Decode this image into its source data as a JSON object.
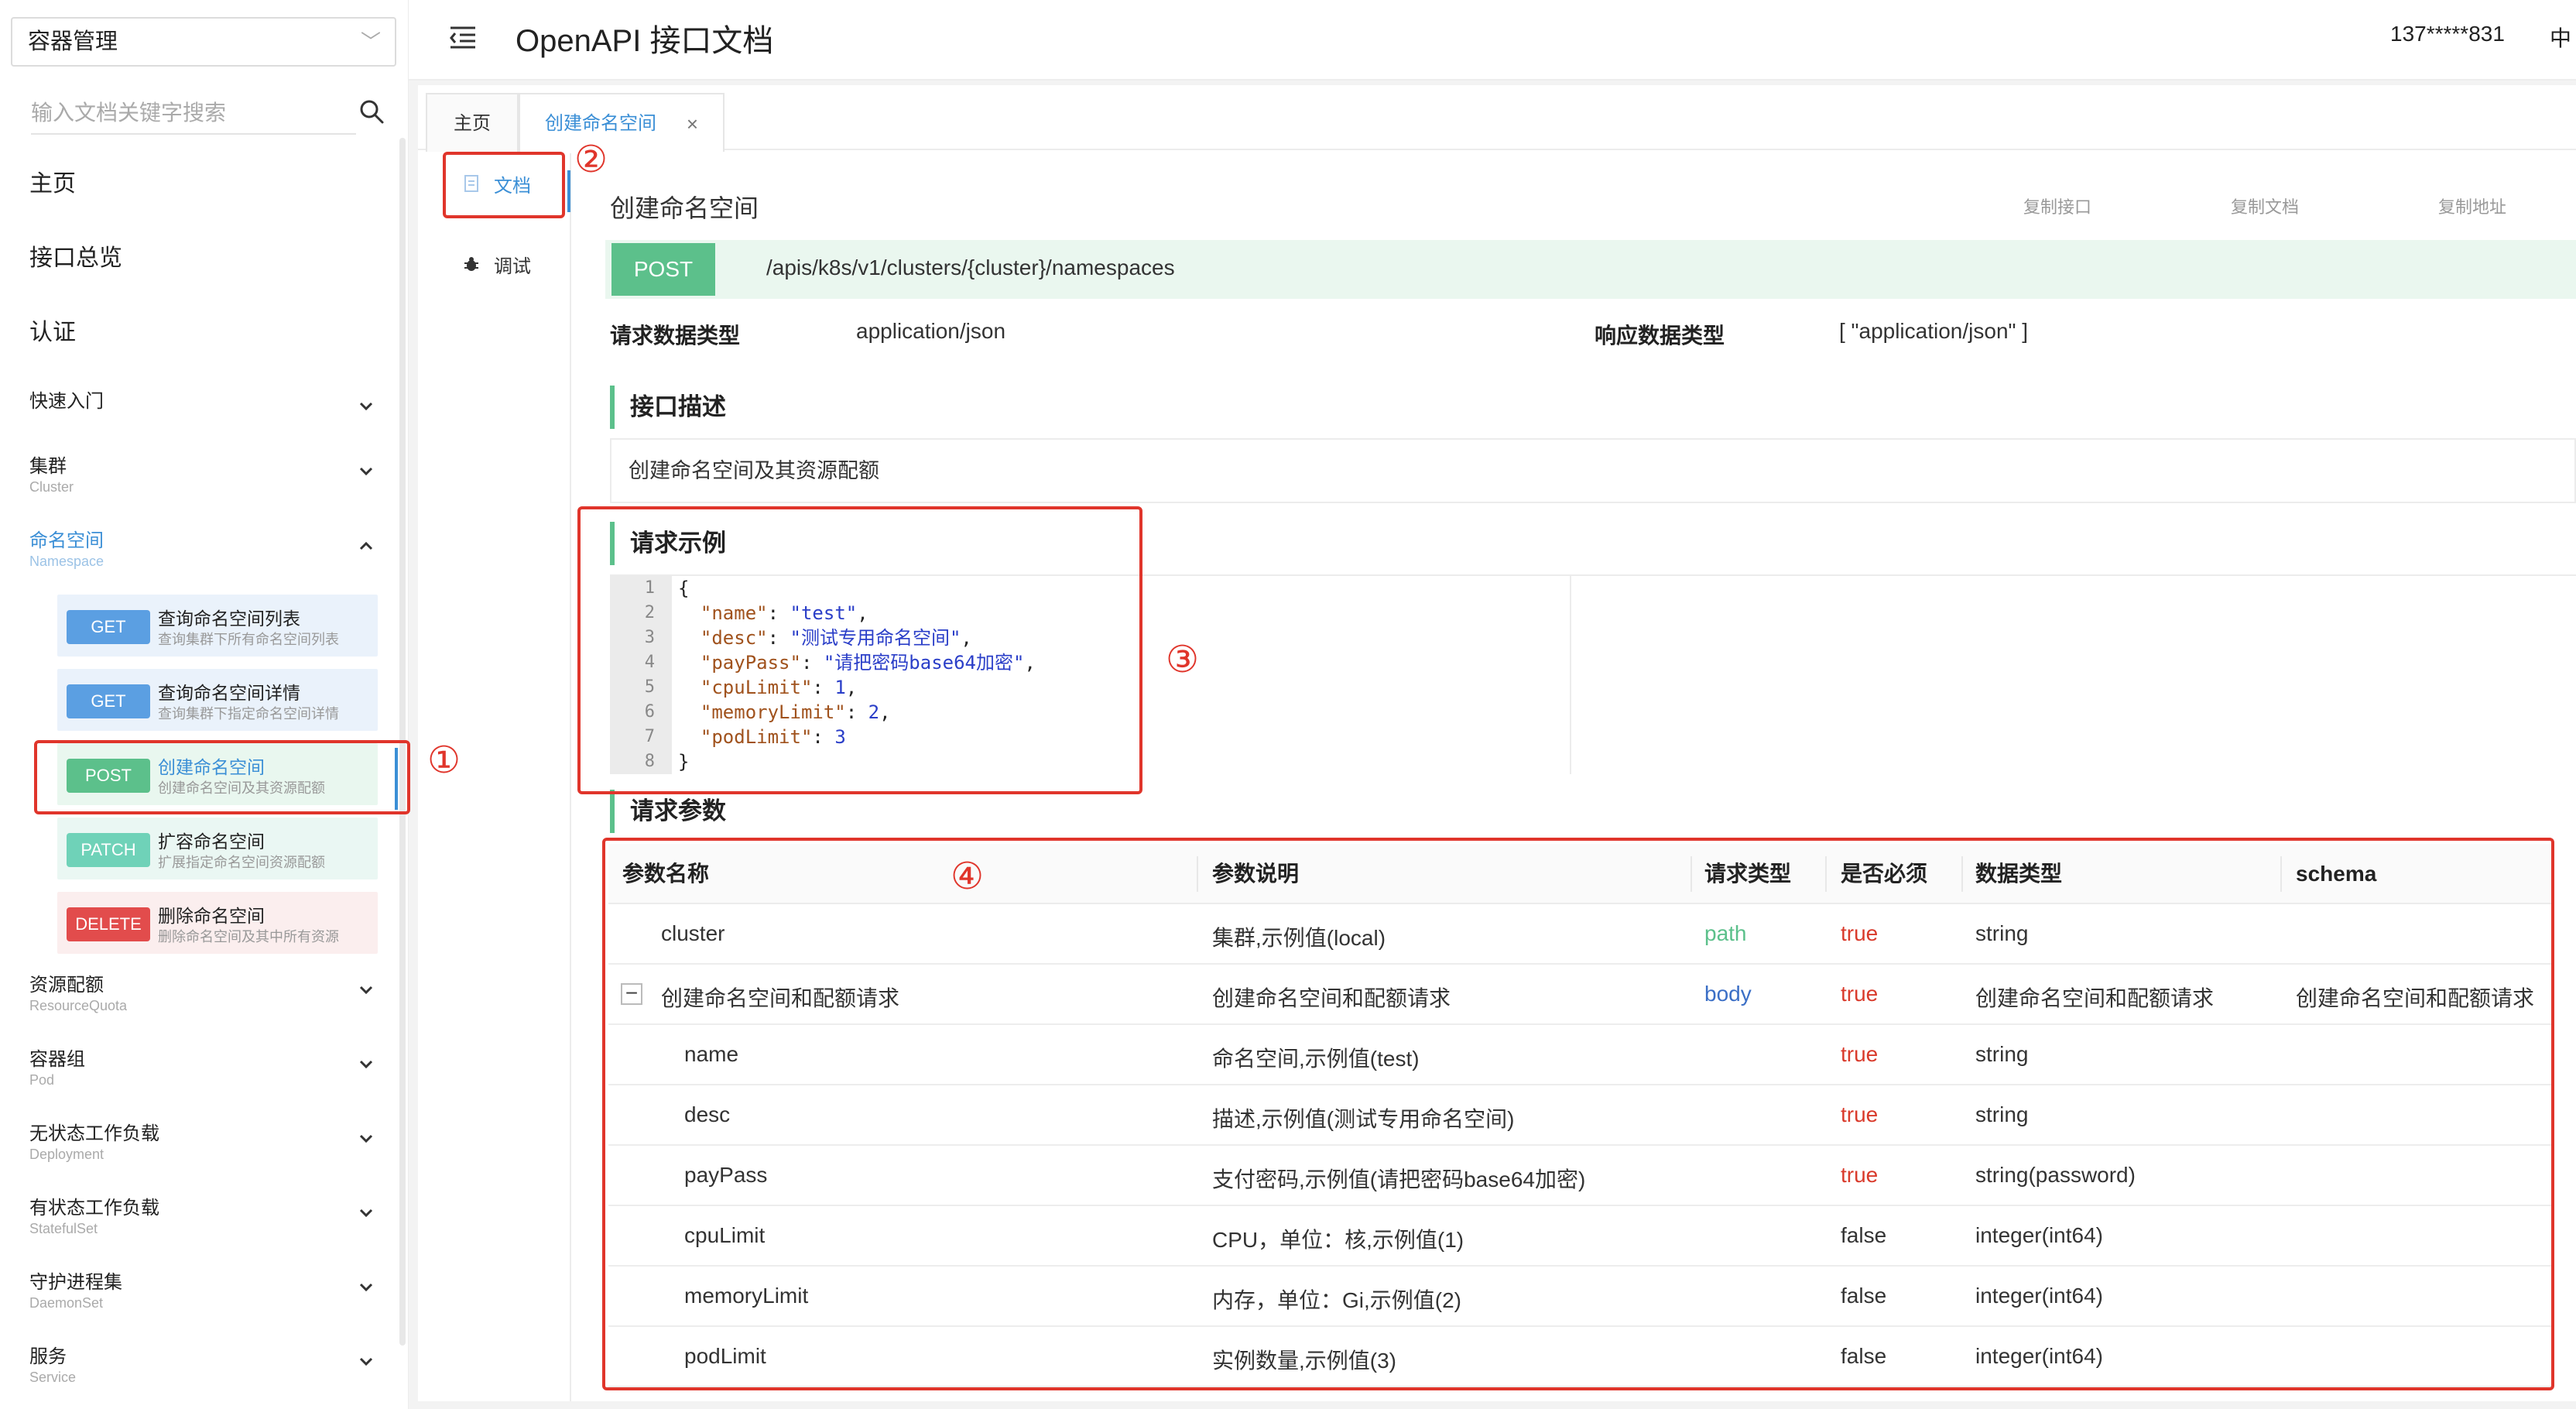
{
  "sidebar": {
    "project_select": "容器管理",
    "search_placeholder": "输入文档关键字搜索",
    "simple_items": [
      "主页",
      "接口总览",
      "认证"
    ],
    "groups": [
      {
        "title": "快速入门",
        "subtitle": ""
      },
      {
        "title": "集群",
        "subtitle": "Cluster"
      },
      {
        "title": "命名空间",
        "subtitle": "Namespace"
      },
      {
        "title": "资源配额",
        "subtitle": "ResourceQuota"
      },
      {
        "title": "容器组",
        "subtitle": "Pod"
      },
      {
        "title": "无状态工作负载",
        "subtitle": "Deployment"
      },
      {
        "title": "有状态工作负载",
        "subtitle": "StatefulSet"
      },
      {
        "title": "守护进程集",
        "subtitle": "DaemonSet"
      },
      {
        "title": "服务",
        "subtitle": "Service"
      }
    ],
    "apis": [
      {
        "method": "GET",
        "name": "查询命名空间列表",
        "desc": "查询集群下所有命名空间列表"
      },
      {
        "method": "GET",
        "name": "查询命名空间详情",
        "desc": "查询集群下指定命名空间详情"
      },
      {
        "method": "POST",
        "name": "创建命名空间",
        "desc": "创建命名空间及其资源配额"
      },
      {
        "method": "PATCH",
        "name": "扩容命名空间",
        "desc": "扩展指定命名空间资源配额"
      },
      {
        "method": "DELETE",
        "name": "删除命名空间",
        "desc": "删除命名空间及其中所有资源"
      }
    ]
  },
  "header": {
    "title": "OpenAPI 接口文档",
    "user": "137*****831",
    "lang": "中"
  },
  "tabs": {
    "home": "主页",
    "current": "创建命名空间",
    "close": "×"
  },
  "view_nav": {
    "doc": "文档",
    "debug": "调试"
  },
  "doc": {
    "title": "创建命名空间",
    "copy_api": "复制接口",
    "copy_doc": "复制文档",
    "copy_url": "复制地址",
    "method": "POST",
    "path": "/apis/k8s/v1/clusters/{cluster}/namespaces",
    "req_type_label": "请求数据类型",
    "req_type_value": "application/json",
    "resp_type_label": "响应数据类型",
    "resp_type_value": "[ \"application/json\" ]",
    "desc_heading": "接口描述",
    "desc_text": "创建命名空间及其资源配额",
    "example_heading": "请求示例",
    "params_heading": "请求参数"
  },
  "code_example": {
    "line_numbers": [
      "1",
      "2",
      "3",
      "4",
      "5",
      "6",
      "7",
      "8"
    ],
    "open": "{",
    "close": "}",
    "entries": [
      {
        "key": "\"name\"",
        "value": "\"test\"",
        "sep": ","
      },
      {
        "key": "\"desc\"",
        "value": "\"测试专用命名空间\"",
        "sep": ","
      },
      {
        "key": "\"payPass\"",
        "value": "\"请把密码base64加密\"",
        "sep": ","
      },
      {
        "key": "\"cpuLimit\"",
        "value": "1",
        "sep": ","
      },
      {
        "key": "\"memoryLimit\"",
        "value": "2",
        "sep": ","
      },
      {
        "key": "\"podLimit\"",
        "value": "3",
        "sep": ""
      }
    ]
  },
  "params_table": {
    "columns": [
      "参数名称",
      "参数说明",
      "请求类型",
      "是否必须",
      "数据类型",
      "schema"
    ],
    "rows": [
      {
        "name": "cluster",
        "desc": "集群,示例值(local)",
        "in": "path",
        "required": "true",
        "type": "string",
        "schema": "",
        "indent": 1,
        "collapsible": false
      },
      {
        "name": "创建命名空间和配额请求",
        "desc": "创建命名空间和配额请求",
        "in": "body",
        "required": "true",
        "type": "创建命名空间和配额请求",
        "schema": "创建命名空间和配额请求",
        "indent": 1,
        "collapsible": true
      },
      {
        "name": "name",
        "desc": "命名空间,示例值(test)",
        "in": "",
        "required": "true",
        "type": "string",
        "schema": "",
        "indent": 2,
        "collapsible": false
      },
      {
        "name": "desc",
        "desc": "描述,示例值(测试专用命名空间)",
        "in": "",
        "required": "true",
        "type": "string",
        "schema": "",
        "indent": 2,
        "collapsible": false
      },
      {
        "name": "payPass",
        "desc": "支付密码,示例值(请把密码base64加密)",
        "in": "",
        "required": "true",
        "type": "string(password)",
        "schema": "",
        "indent": 2,
        "collapsible": false
      },
      {
        "name": "cpuLimit",
        "desc": "CPU，单位：核,示例值(1)",
        "in": "",
        "required": "false",
        "type": "integer(int64)",
        "schema": "",
        "indent": 2,
        "collapsible": false
      },
      {
        "name": "memoryLimit",
        "desc": "内存，单位：Gi,示例值(2)",
        "in": "",
        "required": "false",
        "type": "integer(int64)",
        "schema": "",
        "indent": 2,
        "collapsible": false
      },
      {
        "name": "podLimit",
        "desc": "实例数量,示例值(3)",
        "in": "",
        "required": "false",
        "type": "integer(int64)",
        "schema": "",
        "indent": 2,
        "collapsible": false
      }
    ]
  },
  "annotations": [
    "①",
    "②",
    "③",
    "④"
  ],
  "colors": {
    "accent": "#3b8fd6",
    "post": "#5cc08b",
    "get": "#5b9fe2",
    "patch": "#6fd2b8",
    "delete": "#e24c4c",
    "annotation": "#e0352b"
  }
}
